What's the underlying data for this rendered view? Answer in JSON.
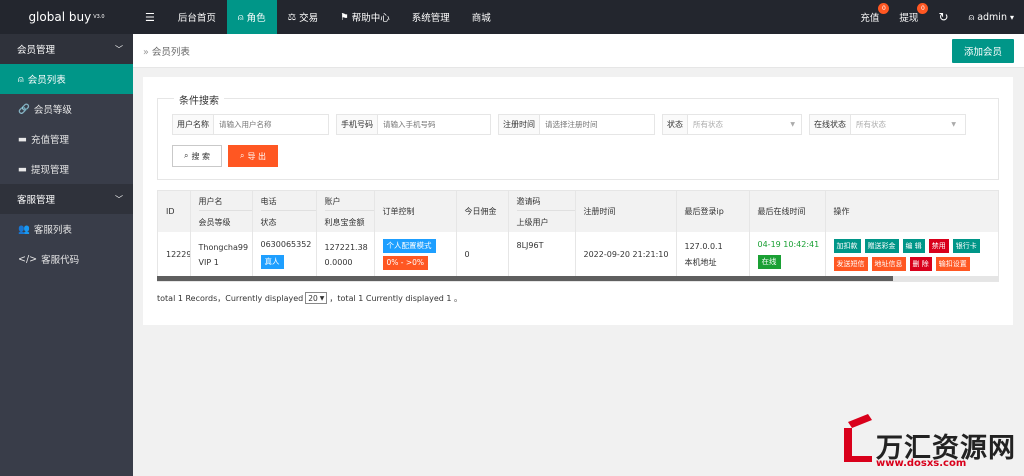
{
  "header": {
    "logo": "global buy",
    "version": "V3.0",
    "nav": [
      {
        "label": "后台首页"
      },
      {
        "label": "角色"
      },
      {
        "label": "交易"
      },
      {
        "label": "帮助中心"
      },
      {
        "label": "系统管理"
      },
      {
        "label": "商城"
      }
    ],
    "recharge_label": "充值",
    "recharge_count": "0",
    "withdraw_label": "提现",
    "withdraw_count": "0",
    "user": "admin"
  },
  "sidebar": {
    "groups": [
      {
        "label": "会员管理",
        "items": [
          {
            "label": "会员列表"
          },
          {
            "label": "会员等级"
          },
          {
            "label": "充值管理"
          },
          {
            "label": "提现管理"
          }
        ]
      },
      {
        "label": "客服管理",
        "items": [
          {
            "label": "客服列表"
          },
          {
            "label": "客服代码"
          }
        ]
      }
    ]
  },
  "breadcrumb": "会员列表",
  "add_button": "添加会员",
  "search": {
    "legend": "条件搜索",
    "username_label": "用户名称",
    "username_placeholder": "请输入用户名称",
    "phone_label": "手机号码",
    "phone_placeholder": "请输入手机号码",
    "regtime_label": "注册时间",
    "regtime_placeholder": "请选择注册时间",
    "status_label": "状态",
    "status_value": "所有状态",
    "online_label": "在线状态",
    "online_value": "所有状态",
    "search_btn": "搜 索",
    "export_btn": "导 出"
  },
  "table": {
    "headers": {
      "id": "ID",
      "username": "用户名",
      "level": "会员等级",
      "phone": "电话",
      "status": "状态",
      "account": "账户",
      "interest": "利息宝金额",
      "order_ctrl": "订单控制",
      "today_comm": "今日佣金",
      "invite": "邀请码",
      "parent": "上级用户",
      "regtime": "注册时间",
      "last_ip": "最后登录ip",
      "last_online": "最后在线时间",
      "ops": "操作"
    },
    "row": {
      "id": "12229",
      "username": "Thongcha99",
      "level": "VIP 1",
      "phone": "0630065352",
      "status_tag": "真人",
      "account": "127221.38",
      "interest": "0.0000",
      "order_mode": "个人配置模式",
      "order_ratio": "0% - >0%",
      "today_comm": "0",
      "invite": "8LJ96T",
      "regtime": "2022-09-20 21:21:10",
      "ip": "127.0.0.1",
      "ip_loc": "本机地址",
      "last_online": "04-19 10:42:41",
      "online_tag": "在线",
      "ops1": [
        "加扣款",
        "赠送彩金",
        "编 辑",
        "禁用",
        "银行卡"
      ],
      "ops2": [
        "发送短信",
        "地址信息",
        "删 除",
        "输扣设置"
      ]
    }
  },
  "pager": {
    "prefix": "total 1 Records，Currently displayed",
    "per_page": "20",
    "suffix": "，total 1 Currently displayed 1 。"
  },
  "watermark": {
    "text": "万汇资源网",
    "url": "www.dosxs.com"
  },
  "colors": {
    "accent": "#009688",
    "header_bg": "#23262e",
    "sidebar_bg": "#393d49",
    "danger": "#ff5722"
  }
}
